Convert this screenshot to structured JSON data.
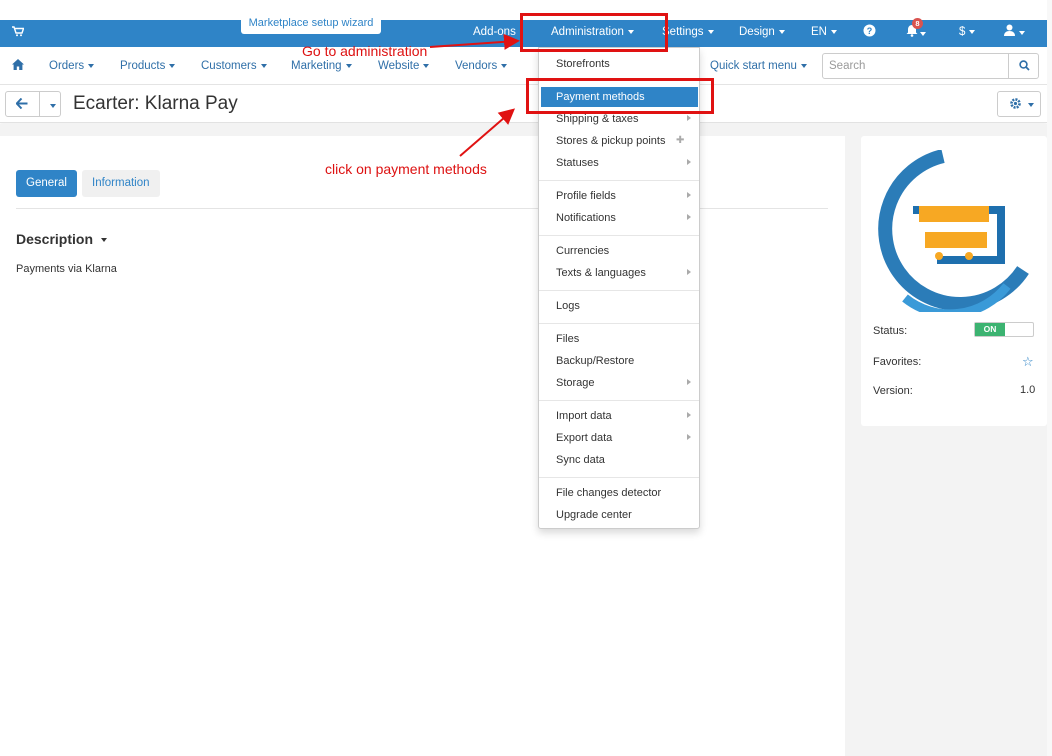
{
  "topbar": {
    "cart_icon": "shopping-cart-icon",
    "wizard_label": "Marketplace setup wizard",
    "addons": "Add-ons",
    "administration": "Administration",
    "settings": "Settings",
    "design": "Design",
    "language": "EN",
    "help_icon": "question-circle-icon",
    "bell_icon": "bell-icon",
    "notifications_count": "8",
    "currency": "$",
    "user_icon": "user-icon"
  },
  "nav": {
    "home_icon": "home-icon",
    "items": [
      "Orders",
      "Products",
      "Customers",
      "Marketing",
      "Website",
      "Vendors"
    ],
    "quick_start": "Quick start menu",
    "search_placeholder": "Search"
  },
  "title": {
    "text": "Ecarter: Klarna Pay"
  },
  "tabs": {
    "general": "General",
    "information": "Information"
  },
  "description": {
    "heading": "Description",
    "text": "Payments via Klarna"
  },
  "sidebar": {
    "status_label": "Status:",
    "status_value": "ON",
    "favorites_label": "Favorites:",
    "version_label": "Version:",
    "version_value": "1.0"
  },
  "dropdown": {
    "items": [
      {
        "label": "Storefronts",
        "submenu": false
      },
      {
        "label": "Payment methods",
        "submenu": false,
        "active": true
      },
      {
        "label": "Shipping & taxes",
        "submenu": true
      },
      {
        "label": "Stores & pickup points",
        "submenu": false
      },
      {
        "label": "Statuses",
        "submenu": true
      },
      {
        "label": "Profile fields",
        "submenu": true
      },
      {
        "label": "Notifications",
        "submenu": true
      },
      {
        "label": "Currencies",
        "submenu": false
      },
      {
        "label": "Texts & languages",
        "submenu": true
      },
      {
        "label": "Logs",
        "submenu": false
      },
      {
        "label": "Files",
        "submenu": false
      },
      {
        "label": "Backup/Restore",
        "submenu": false
      },
      {
        "label": "Storage",
        "submenu": true
      },
      {
        "label": "Import data",
        "submenu": true
      },
      {
        "label": "Export data",
        "submenu": true
      },
      {
        "label": "Sync data",
        "submenu": false
      },
      {
        "label": "File changes detector",
        "submenu": false
      },
      {
        "label": "Upgrade center",
        "submenu": false
      }
    ]
  },
  "annotations": {
    "go_to_admin": "Go to administration",
    "click_payment": "click on payment methods",
    "color": "#e01212"
  },
  "colors": {
    "primary": "#2f84c7",
    "status_on": "#3cb371"
  }
}
